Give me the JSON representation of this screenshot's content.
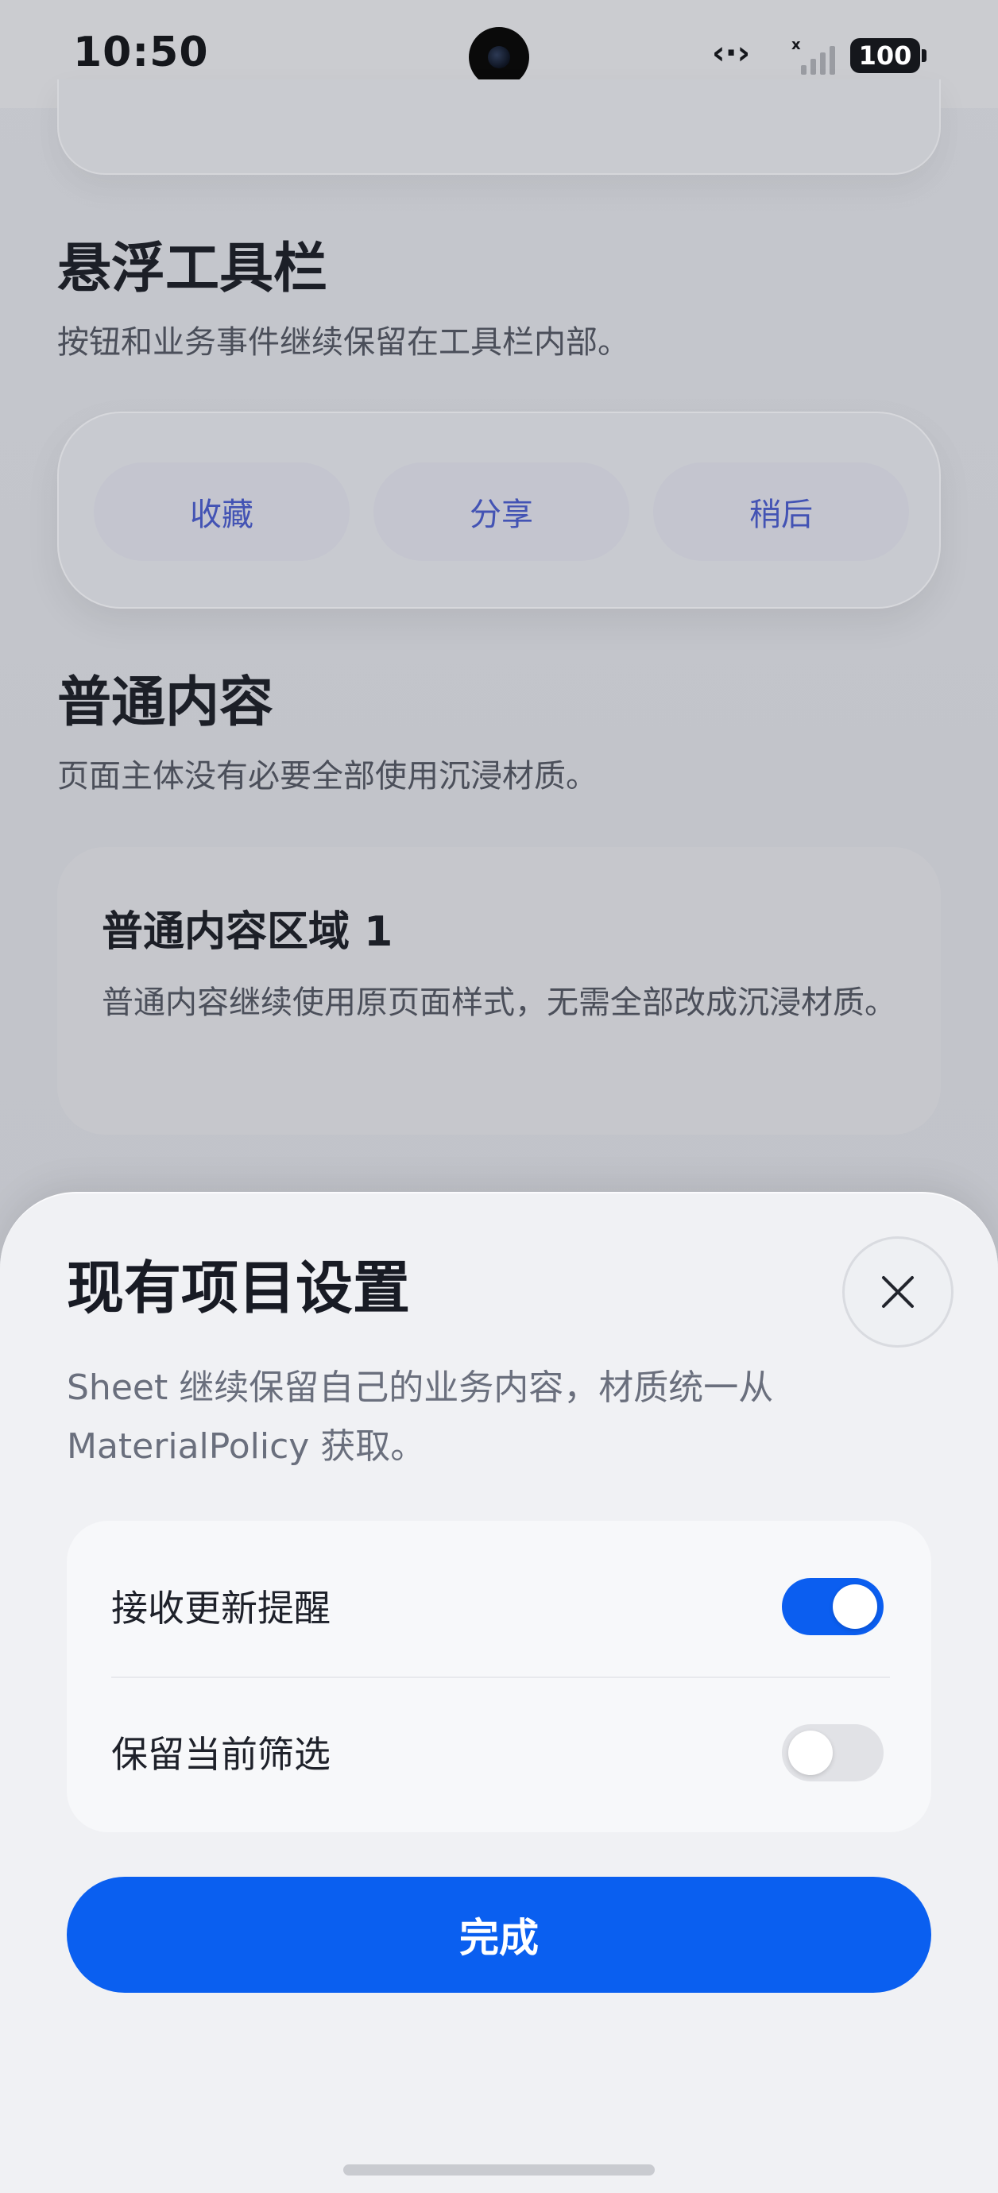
{
  "status_bar": {
    "time": "10:50",
    "battery": "100",
    "icons": [
      "link-icon",
      "signal-icon",
      "battery-icon"
    ]
  },
  "page": {
    "floating_toolbar": {
      "title": "悬浮工具栏",
      "subtitle": "按钮和业务事件继续保留在工具栏内部。",
      "buttons": [
        "收藏",
        "分享",
        "稍后"
      ]
    },
    "regular_content": {
      "title": "普通内容",
      "subtitle": "页面主体没有必要全部使用沉浸材质。",
      "card": {
        "title": "普通内容区域 1",
        "body": "普通内容继续使用原页面样式，无需全部改成沉浸材质。"
      }
    }
  },
  "sheet": {
    "title": "现有项目设置",
    "description": "Sheet 继续保留自己的业务内容，材质统一从 MaterialPolicy 获取。",
    "settings": [
      {
        "label": "接收更新提醒",
        "enabled": true
      },
      {
        "label": "保留当前筛选",
        "enabled": false
      }
    ],
    "done_label": "完成"
  },
  "colors": {
    "accent": "#0a5ff0",
    "toolbar_text": "#4353b4",
    "toggle_off": "#e1e2e6"
  }
}
